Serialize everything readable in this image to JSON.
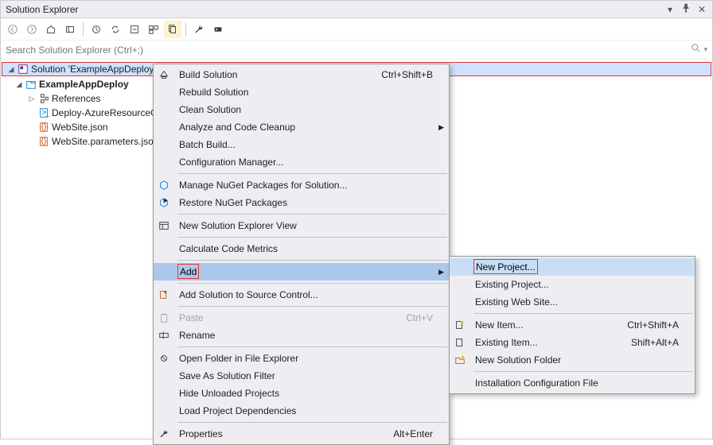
{
  "titlebar": {
    "text": "Solution Explorer"
  },
  "search": {
    "placeholder": "Search Solution Explorer (Ctrl+;)"
  },
  "tree": {
    "solution": "Solution 'ExampleAppDeploy'",
    "project": "ExampleAppDeploy",
    "references": "References",
    "items": [
      "Deploy-AzureResourceG",
      "WebSite.json",
      "WebSite.parameters.jso"
    ]
  },
  "menu": {
    "build": "Build Solution",
    "build_kb": "Ctrl+Shift+B",
    "rebuild": "Rebuild Solution",
    "clean": "Clean Solution",
    "analyze": "Analyze and Code Cleanup",
    "batch": "Batch Build...",
    "config": "Configuration Manager...",
    "nuget_manage": "Manage NuGet Packages for Solution...",
    "nuget_restore": "Restore NuGet Packages",
    "new_view": "New Solution Explorer View",
    "metrics": "Calculate Code Metrics",
    "add": "Add",
    "source_ctrl": "Add Solution to Source Control...",
    "paste": "Paste",
    "paste_kb": "Ctrl+V",
    "rename": "Rename",
    "open_folder": "Open Folder in File Explorer",
    "save_filter": "Save As Solution Filter",
    "hide_unloaded": "Hide Unloaded Projects",
    "load_deps": "Load Project Dependencies",
    "properties": "Properties",
    "properties_kb": "Alt+Enter"
  },
  "submenu": {
    "new_project": "New Project...",
    "existing_project": "Existing Project...",
    "existing_website": "Existing Web Site...",
    "new_item": "New Item...",
    "new_item_kb": "Ctrl+Shift+A",
    "existing_item": "Existing Item...",
    "existing_item_kb": "Shift+Alt+A",
    "new_folder": "New Solution Folder",
    "install_config": "Installation Configuration File"
  }
}
